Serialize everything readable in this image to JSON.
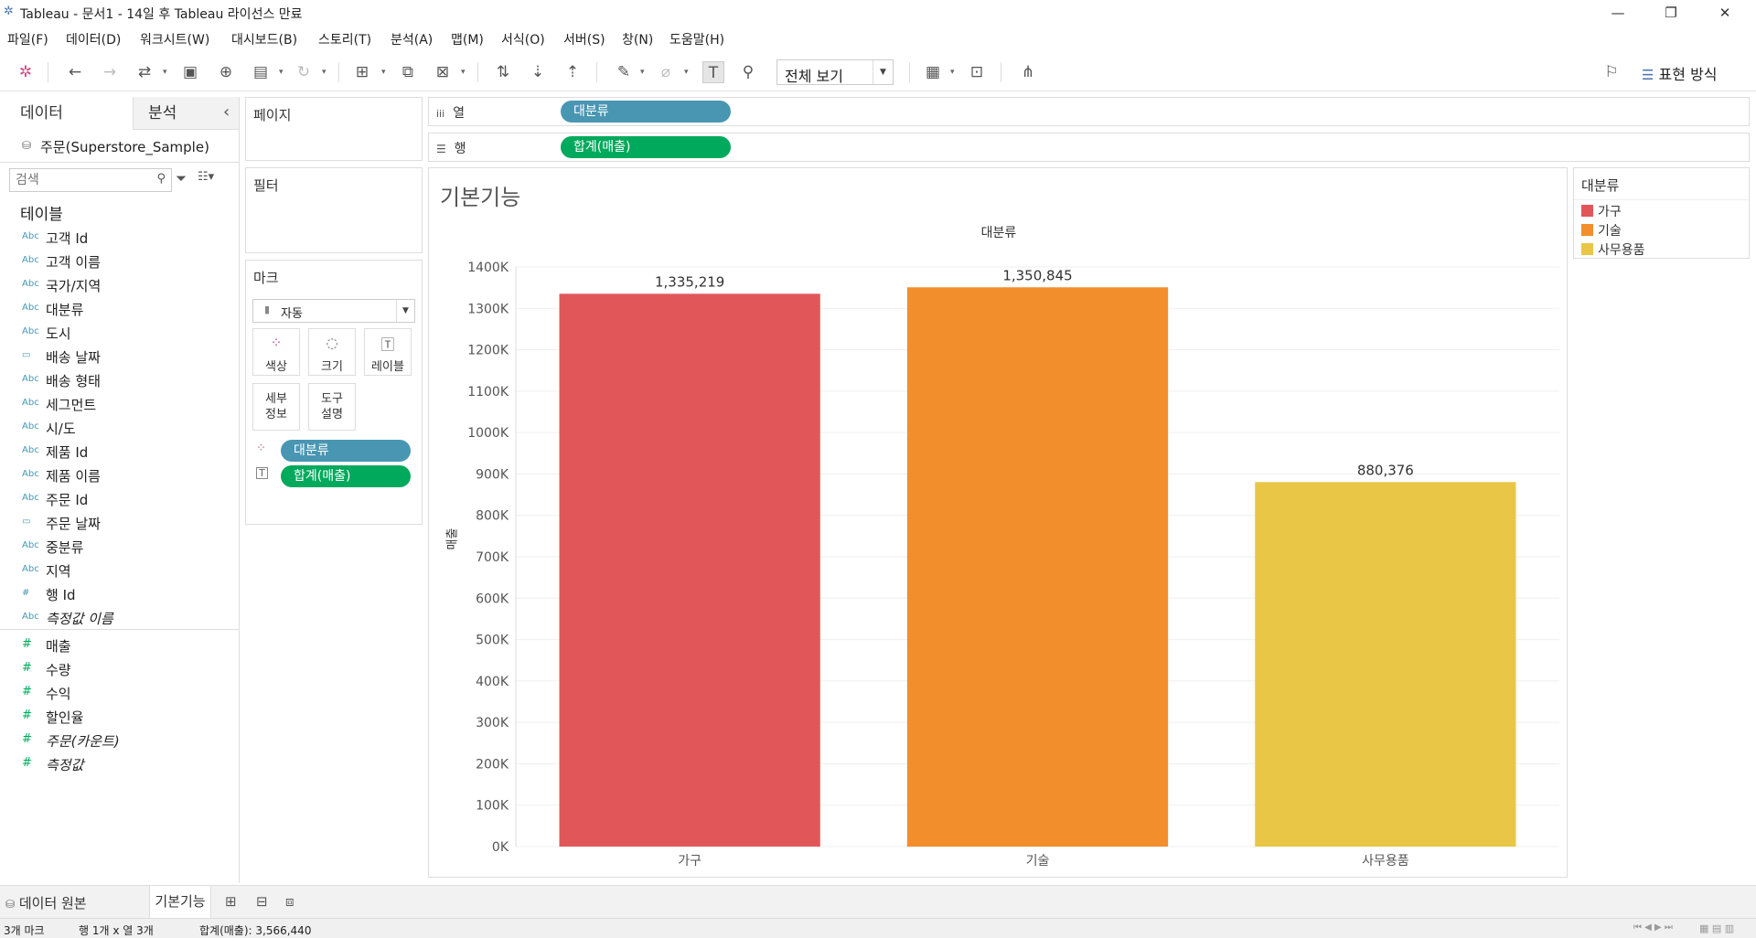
{
  "window": {
    "title": "Tableau - 문서1 - 14일 후 Tableau 라이선스 만료",
    "minimize": "—",
    "maximize": "❐",
    "close": "✕"
  },
  "menu": [
    "파일(F)",
    "데이터(D)",
    "워크시트(W)",
    "대시보드(B)",
    "스토리(T)",
    "분석(A)",
    "맵(M)",
    "서식(O)",
    "서버(S)",
    "창(N)",
    "도움말(H)"
  ],
  "toolbar": {
    "fit_label": "전체 보기",
    "show_me_label": "표현 방식"
  },
  "data_pane": {
    "tab_data": "데이터",
    "tab_analysis": "분석",
    "collapse": "‹",
    "datasource": "주문(Superstore_Sample)",
    "search_placeholder": "검색",
    "tables_heading": "테이블",
    "dimensions": [
      {
        "icon": "Abc",
        "name": "고객 Id"
      },
      {
        "icon": "Abc",
        "name": "고객 이름"
      },
      {
        "icon": "Abc",
        "name": "국가/지역"
      },
      {
        "icon": "Abc",
        "name": "대분류"
      },
      {
        "icon": "Abc",
        "name": "도시"
      },
      {
        "icon": "▭",
        "name": "배송 날짜"
      },
      {
        "icon": "Abc",
        "name": "배송 형태"
      },
      {
        "icon": "Abc",
        "name": "세그먼트"
      },
      {
        "icon": "Abc",
        "name": "시/도"
      },
      {
        "icon": "Abc",
        "name": "제품 Id"
      },
      {
        "icon": "Abc",
        "name": "제품 이름"
      },
      {
        "icon": "Abc",
        "name": "주문 Id"
      },
      {
        "icon": "▭",
        "name": "주문 날짜"
      },
      {
        "icon": "Abc",
        "name": "중분류"
      },
      {
        "icon": "Abc",
        "name": "지역"
      },
      {
        "icon": "#",
        "name": "행 Id"
      },
      {
        "icon": "Abc",
        "name": "측정값 이름"
      }
    ],
    "measures": [
      {
        "icon": "#",
        "name": "매출"
      },
      {
        "icon": "#",
        "name": "수량"
      },
      {
        "icon": "#",
        "name": "수익"
      },
      {
        "icon": "#",
        "name": "할인율"
      },
      {
        "icon": "#",
        "name": "주문(카운트)"
      },
      {
        "icon": "#",
        "name": "측정값"
      }
    ]
  },
  "cards": {
    "pages": "페이지",
    "filters": "필터",
    "marks": "마크",
    "mark_type": "자동",
    "mark_buttons": [
      {
        "icon": "color-icon",
        "label": "색상"
      },
      {
        "icon": "size-icon",
        "label": "크기"
      },
      {
        "icon": "label-icon",
        "label": "레이블"
      },
      {
        "icon": "detail-icon",
        "label": "세부\n정보"
      },
      {
        "icon": "tooltip-icon",
        "label": "도구\n설명"
      }
    ],
    "mark_pills": [
      {
        "label": "대분류",
        "kind": "dimension"
      },
      {
        "label": "합계(매출)",
        "kind": "measure"
      }
    ]
  },
  "shelves": {
    "columns_label": "열",
    "columns_pill": "대분류",
    "rows_label": "행",
    "rows_pill": "합계(매출)"
  },
  "sheet": {
    "title": "기본기능",
    "header": "대분류",
    "y_axis_title": "매출"
  },
  "chart_data": {
    "type": "bar",
    "categories": [
      "가구",
      "기술",
      "사무용품"
    ],
    "values": [
      1335219,
      1350845,
      880376
    ],
    "value_labels": [
      "1,335,219",
      "1,350,845",
      "880,376"
    ],
    "colors": [
      "#e15759",
      "#f28e2b",
      "#e9c646"
    ],
    "title": "기본기능",
    "xlabel": "대분류",
    "ylabel": "매출",
    "ylim": [
      0,
      1400000
    ],
    "yticks": [
      0,
      100000,
      200000,
      300000,
      400000,
      500000,
      600000,
      700000,
      800000,
      900000,
      1000000,
      1100000,
      1200000,
      1300000,
      1400000
    ],
    "ytick_labels": [
      "0K",
      "100K",
      "200K",
      "300K",
      "400K",
      "500K",
      "600K",
      "700K",
      "800K",
      "900K",
      "1000K",
      "1100K",
      "1200K",
      "1300K",
      "1400K"
    ],
    "grid": true
  },
  "legend": {
    "title": "대분류",
    "items": [
      {
        "label": "가구",
        "color": "#e15759"
      },
      {
        "label": "기술",
        "color": "#f28e2b"
      },
      {
        "label": "사무용품",
        "color": "#e9c646"
      }
    ]
  },
  "tabs": {
    "data_source": "데이터 원본",
    "sheet": "기본기능"
  },
  "status": {
    "marks": "3개 마크",
    "rows_cols": "행 1개  x  열 3개",
    "sum": "합계(매출): 3,566,440"
  }
}
